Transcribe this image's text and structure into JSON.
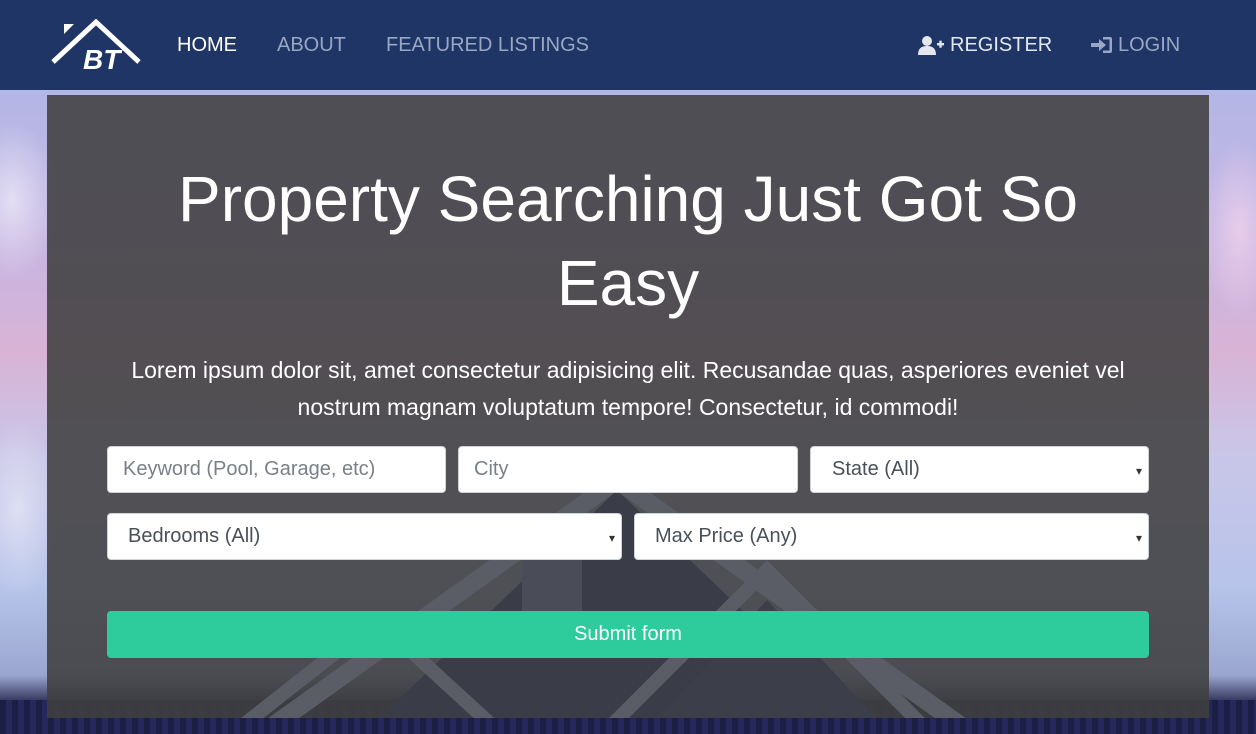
{
  "brand": {
    "logo_text": "BT"
  },
  "nav": {
    "home": "HOME",
    "about": "ABOUT",
    "featured": "FEATURED LISTINGS",
    "register": "REGISTER",
    "login": "LOGIN",
    "register_icon": "user-plus-icon",
    "login_icon": "sign-in-icon"
  },
  "showcase": {
    "title": "Property Searching Just Got So Easy",
    "lead": "Lorem ipsum dolor sit, amet consectetur adipisicing elit. Recusandae quas, asperiores eveniet vel nostrum magnam voluptatum tempore! Consectetur, id commodi!"
  },
  "search_form": {
    "keyword_placeholder": "Keyword (Pool, Garage, etc)",
    "city_placeholder": "City",
    "state_selected": "State (All)",
    "bedrooms_selected": "Bedrooms (All)",
    "max_price_selected": "Max Price (Any)",
    "caret": "▾",
    "submit_label": "Submit form"
  },
  "colors": {
    "navbar": "#1f3566",
    "accent": "#2ecc9c",
    "overlay": "#404040"
  }
}
